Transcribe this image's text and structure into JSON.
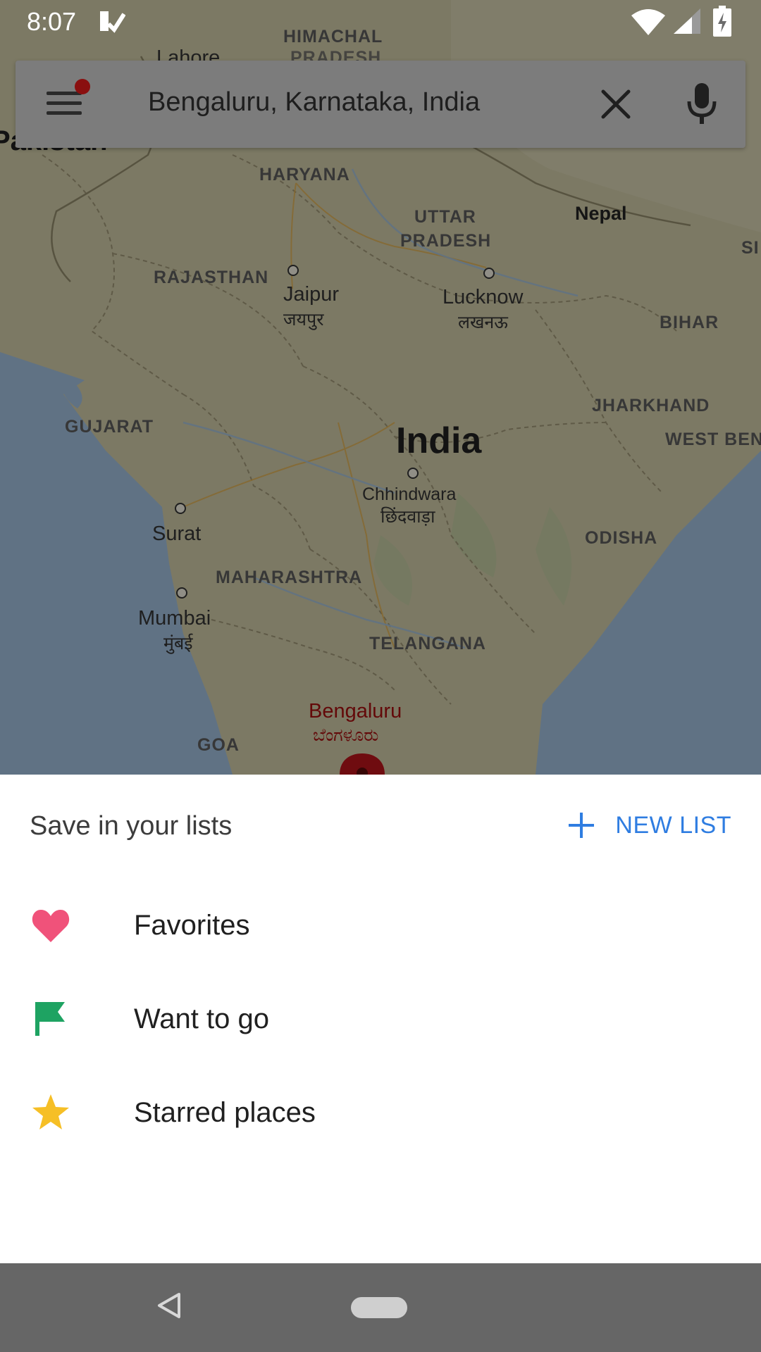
{
  "status_bar": {
    "time": "8:07",
    "icons": [
      "app-notification-icon",
      "wifi-icon",
      "cell-signal-icon",
      "battery-charging-icon"
    ]
  },
  "search_bar": {
    "query": "Bengaluru, Karnataka, India",
    "menu_icon": "hamburger-menu-icon",
    "clear_icon": "close-icon",
    "voice_icon": "microphone-icon",
    "has_notification": true
  },
  "map": {
    "labels": {
      "himachal": "HIMACHAL",
      "pradesh_top": "PRADESH",
      "lahore": "Lahore",
      "pakistan": "Pakistan",
      "haryana": "HARYANA",
      "uttar": "UTTAR",
      "pradesh": "PRADESH",
      "nepal": "Nepal",
      "si": "SI",
      "rajasthan": "RAJASTHAN",
      "jaipur": "Jaipur",
      "jaipur_local": "जयपुर",
      "lucknow": "Lucknow",
      "lucknow_local": "लखनऊ",
      "bihar": "BIHAR",
      "jharkhand": "JHARKHAND",
      "gujarat": "GUJARAT",
      "india": "India",
      "west_bengal": "WEST BEN",
      "chhindwara": "Chhindwara",
      "chhindwara_local": "छिंदवाड़ा",
      "surat": "Surat",
      "odisha": "ODISHA",
      "maharashtra": "MAHARASHTRA",
      "mumbai": "Mumbai",
      "mumbai_local": "मुंबई",
      "telangana": "TELANGANA",
      "bengaluru": "Bengaluru",
      "bengaluru_local": "ಬೆಂಗಳೂರು",
      "goa": "GOA"
    },
    "pin_icon": "location-pin-icon"
  },
  "sheet": {
    "title": "Save in your lists",
    "new_list_label": "NEW LIST",
    "items": [
      {
        "label": "Favorites",
        "icon": "heart-icon",
        "color": "#f0527a"
      },
      {
        "label": "Want to go",
        "icon": "flag-icon",
        "color": "#1ea362"
      },
      {
        "label": "Starred places",
        "icon": "star-icon",
        "color": "#f6bf26"
      }
    ],
    "accent_color": "#2f7de1"
  },
  "nav_bar": {
    "back_icon": "back-triangle-icon",
    "home_icon": "home-pill-icon"
  }
}
